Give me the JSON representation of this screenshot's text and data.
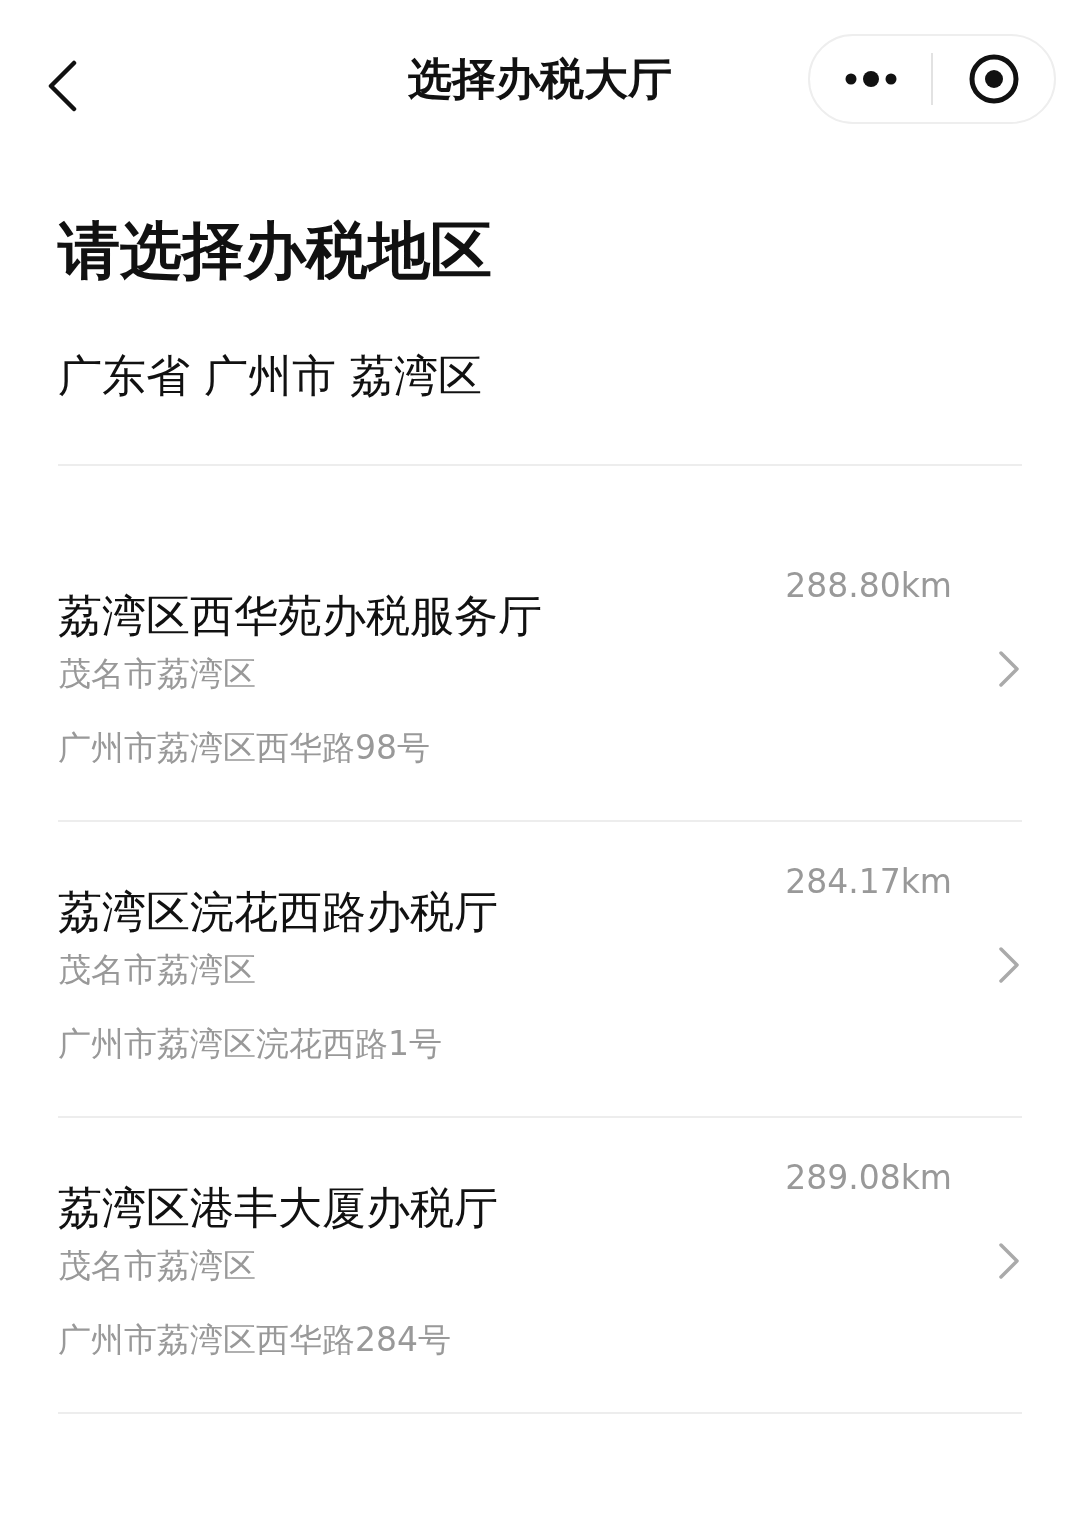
{
  "nav": {
    "title": "选择办税大厅"
  },
  "heading": "请选择办税地区",
  "region": "广东省 广州市 荔湾区",
  "halls": [
    {
      "name": "荔湾区西华苑办税服务厅",
      "distance": "288.80km",
      "area": "茂名市荔湾区",
      "address": "广州市荔湾区西华路98号"
    },
    {
      "name": "荔湾区浣花西路办税厅",
      "distance": "284.17km",
      "area": "茂名市荔湾区",
      "address": "广州市荔湾区浣花西路1号"
    },
    {
      "name": "荔湾区港丰大厦办税厅",
      "distance": "289.08km",
      "area": "茂名市荔湾区",
      "address": "广州市荔湾区西华路284号"
    }
  ]
}
